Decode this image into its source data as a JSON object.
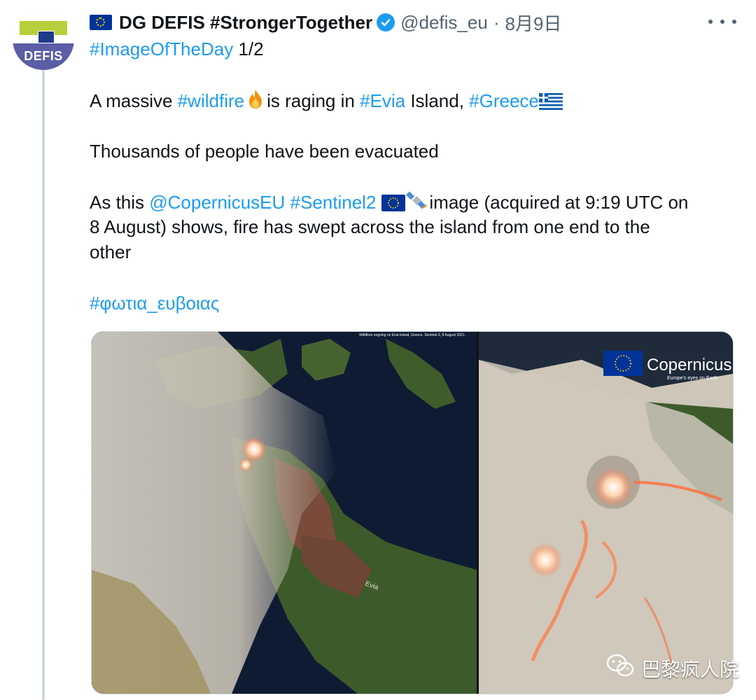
{
  "tweet": {
    "author_name": "DG DEFIS #StrongerTogether",
    "handle": "@defis_eu",
    "separator": "·",
    "date": "8月9日",
    "avatar_text": "DEFIS",
    "line1_tag": "#ImageOfTheDay",
    "line1_suffix": "1/2",
    "line2": {
      "a": "A massive ",
      "b": "#wildfire",
      "c": "is raging in ",
      "d": "#Evia",
      "e": " Island, ",
      "f": "#Greece"
    },
    "line3": "Thousands of people have been evacuated",
    "line4": {
      "a": "As this ",
      "b": "@CopernicusEU",
      "c": " ",
      "d": "#Sentinel2",
      "e": "image (acquired at 9:19 UTC on"
    },
    "line5": "8 August) shows, fire has swept across the island from one end to the",
    "line6": "other",
    "line7": "#φωτια_ευβοιας"
  },
  "media": {
    "caption": "Wildfires ongoing on Evia Island, Greece. Sentinel-2, 8 August 2021.",
    "map_label": "Evia",
    "logo_text": "Copernicus",
    "logo_subtext": "Europe's eyes on Earth"
  },
  "watermark": "巴黎疯人院",
  "colors": {
    "link": "#1d9bf0",
    "secondary_text": "#536471",
    "verified": "#1d9bf0",
    "eu_blue": "#003399"
  }
}
